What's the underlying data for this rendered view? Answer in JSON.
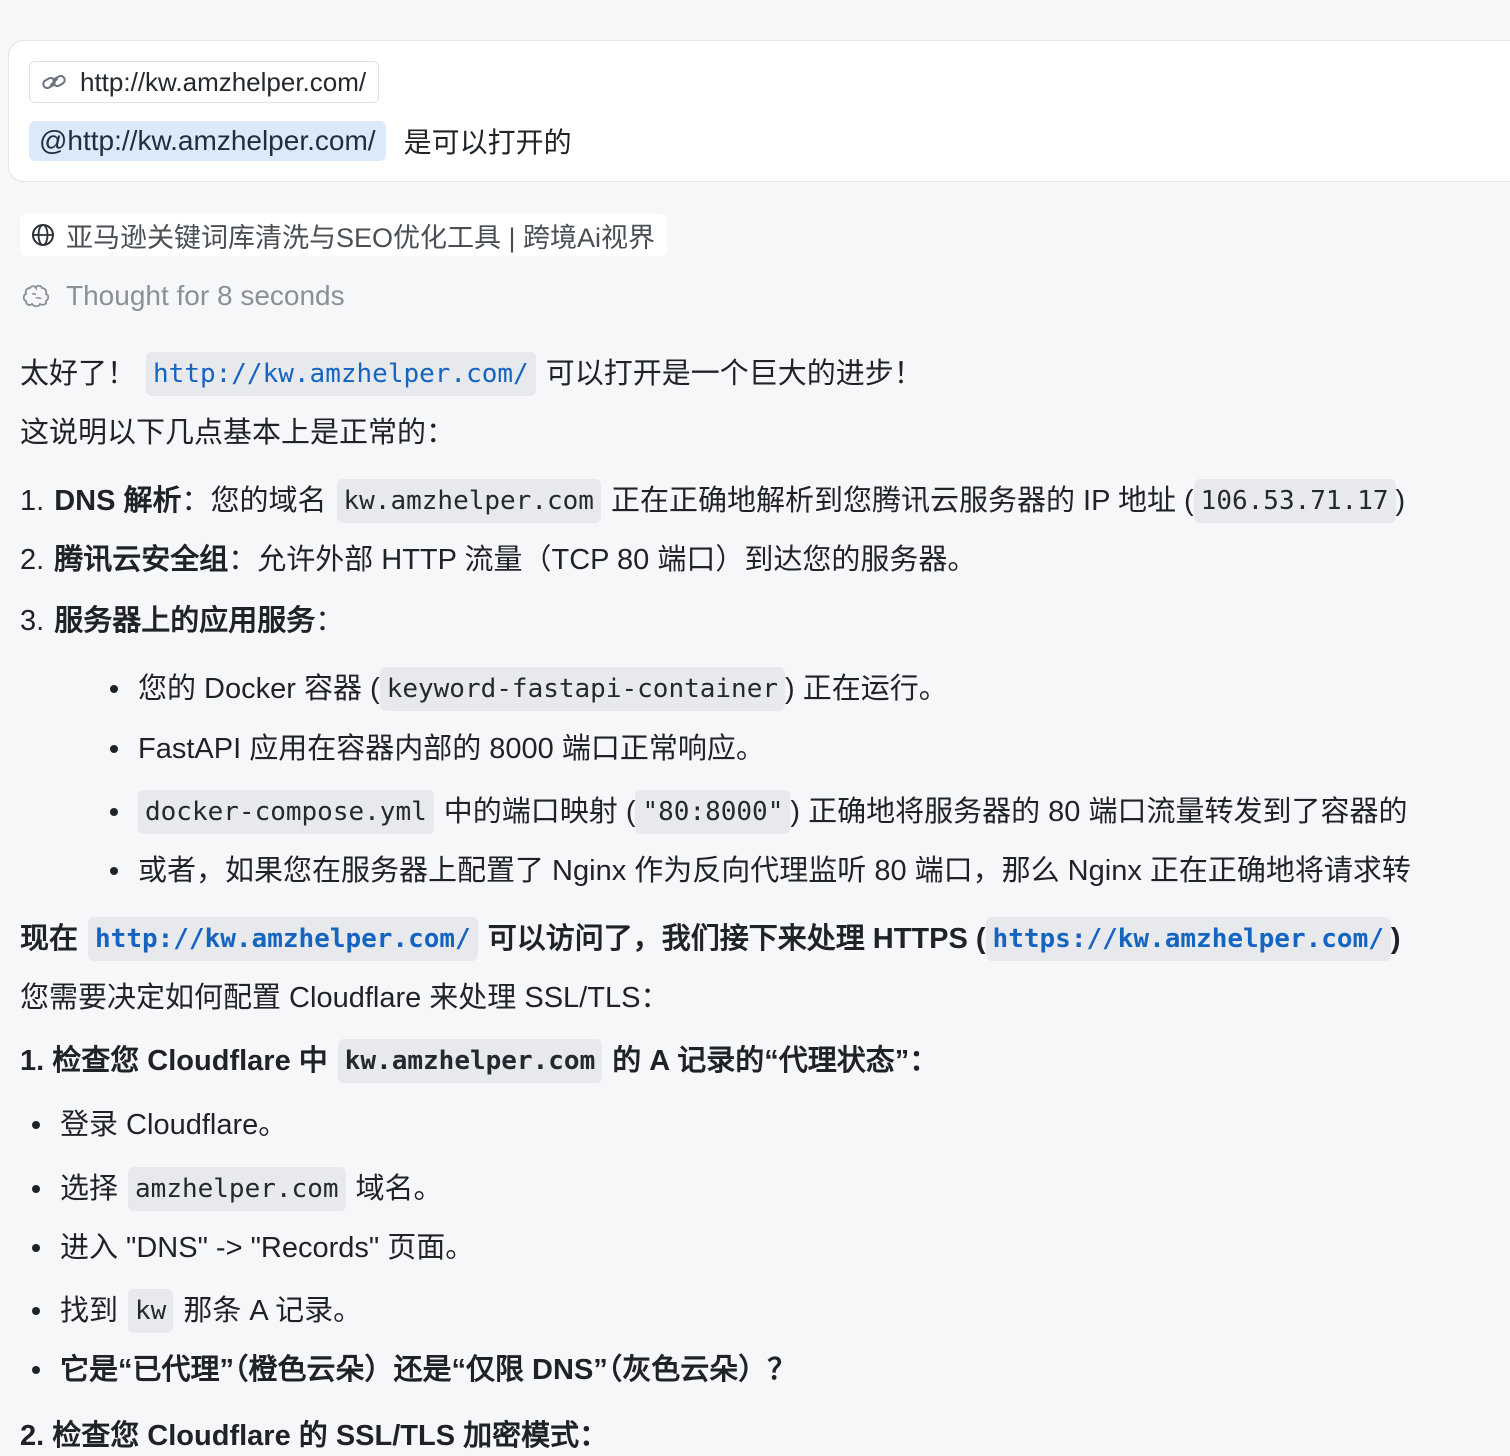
{
  "user_message": {
    "link_chip": "http://kw.amzhelper.com/",
    "mention": "@http://kw.amzhelper.com/",
    "text": "是可以打开的"
  },
  "web_result": {
    "title": "亚马逊关键词库清洗与SEO优化工具 | 跨境Ai视界"
  },
  "thought": "Thought for 8 seconds",
  "answer": {
    "intro1_a": "太好了！",
    "intro1_code": "http://kw.amzhelper.com/",
    "intro1_b": "可以打开是一个巨大的进步！",
    "intro2": "这说明以下几点基本上是正常的：",
    "item1_num": "1.",
    "item1_bold": "DNS 解析",
    "item1_a": "：您的域名",
    "item1_code1": "kw.amzhelper.com",
    "item1_b": "正在正确地解析到您腾讯云服务器的 IP 地址 (",
    "item1_code2": "106.53.71.17",
    "item1_c": ")",
    "item2_num": "2.",
    "item2_bold": "腾讯云安全组",
    "item2_text": "：允许外部 HTTP 流量（TCP 80 端口）到达您的服务器。",
    "item3_num": "3.",
    "item3_bold": "服务器上的应用服务",
    "item3_colon": "：",
    "sub1_a": "您的 Docker 容器 (",
    "sub1_code": "keyword-fastapi-container",
    "sub1_b": ") 正在运行。",
    "sub2": "FastAPI 应用在容器内部的 8000 端口正常响应。",
    "sub3_code1": "docker-compose.yml",
    "sub3_a": "中的端口映射 (",
    "sub3_code2": "\"80:8000\"",
    "sub3_b": ") 正确地将服务器的 80 端口流量转发到了容器的",
    "sub4": "或者，如果您在服务器上配置了 Nginx 作为反向代理监听 80 端口，那么 Nginx 正在正确地将请求转",
    "now_a": "现在",
    "now_code1": "http://kw.amzhelper.com/",
    "now_b": "可以访问了，我们接下来处理 HTTPS (",
    "now_code2": "https://kw.amzhelper.com/",
    "now_c": ")",
    "decide": "您需要决定如何配置 Cloudflare 来处理 SSL/TLS：",
    "step1_a": "1. 检查您 Cloudflare 中",
    "step1_code": "kw.amzhelper.com",
    "step1_b": "的 A 记录的“代理状态”：",
    "b1": "登录 Cloudflare。",
    "b2_a": "选择",
    "b2_code": "amzhelper.com",
    "b2_b": "域名。",
    "b3": "进入 \"DNS\" -> \"Records\" 页面。",
    "b4_a": "找到",
    "b4_code": "kw",
    "b4_b": "那条 A 记录。",
    "b5": "它是“已代理”（橙色云朵）还是“仅限 DNS”（灰色云朵）？",
    "step2": "2. 检查您 Cloudflare 的 SSL/TLS 加密模式："
  },
  "colors": {
    "background": "#f6f7f9",
    "link": "#1565c0",
    "code_bg": "#e7e9ec",
    "mention_bg": "#dbe9f9"
  }
}
